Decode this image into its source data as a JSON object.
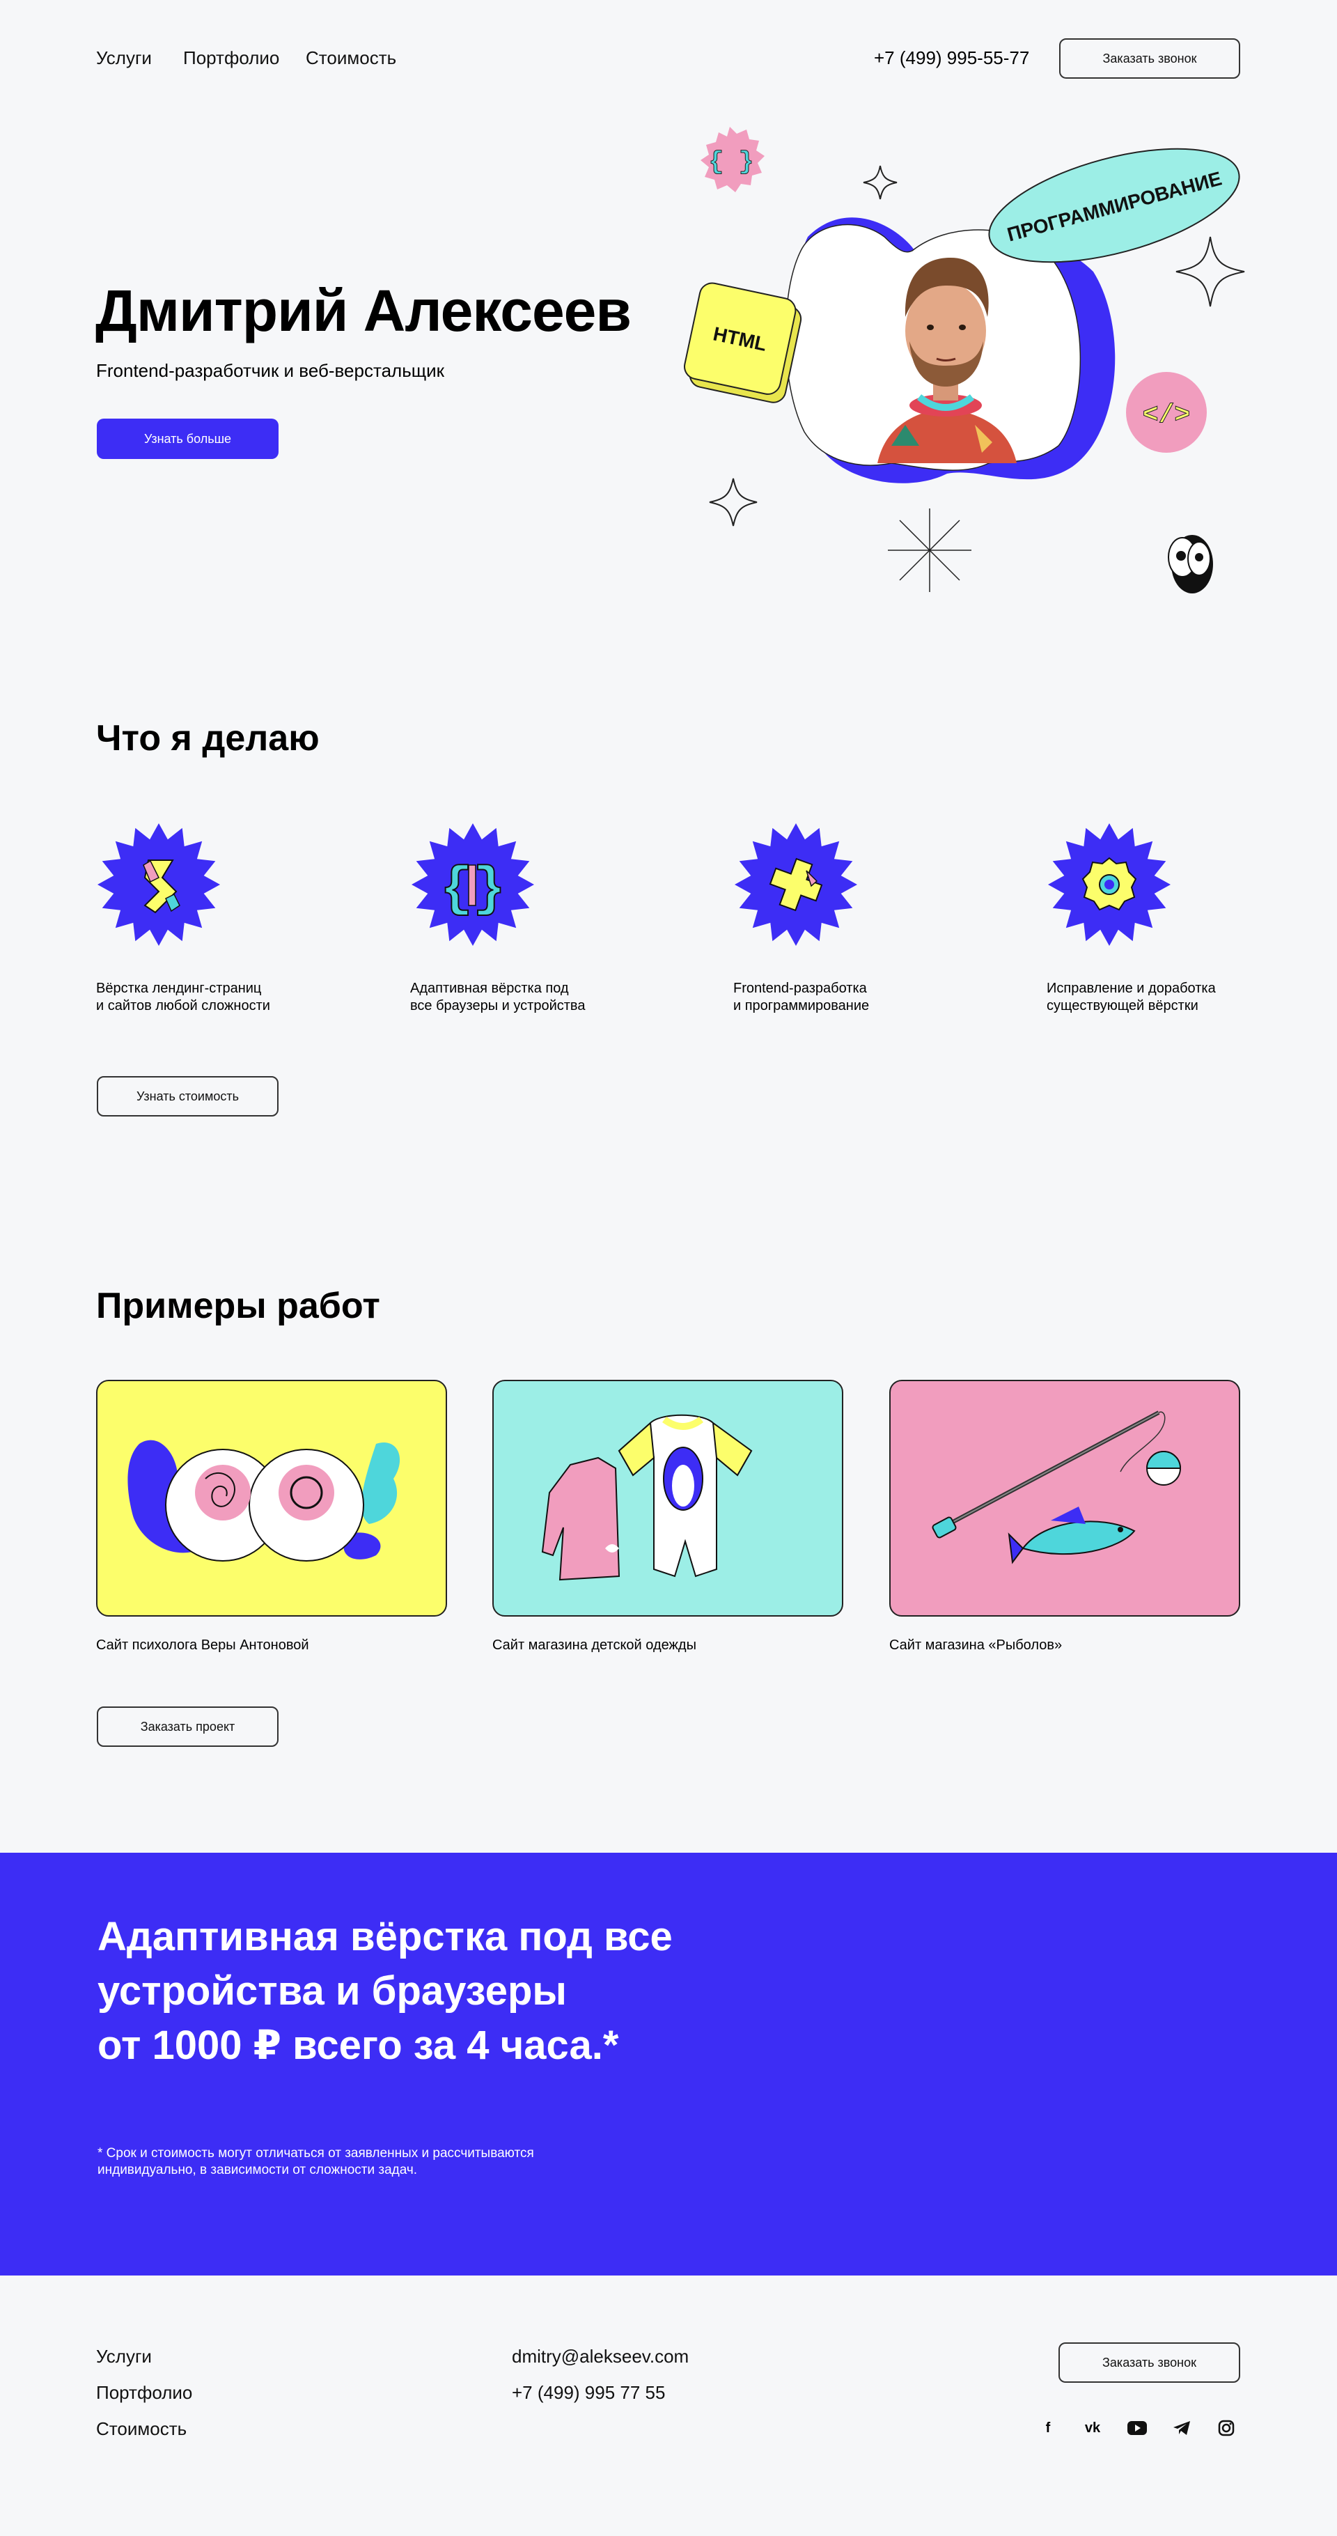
{
  "header": {
    "nav": [
      "Услуги",
      "Портфолио",
      "Стоимость"
    ],
    "phone": "+7 (499) 995-55-77",
    "call_button": "Заказать звонок"
  },
  "hero": {
    "title": "Дмитрий Алексеев",
    "subtitle": "Frontend-разработчик и веб-верстальщик",
    "button": "Узнать больше",
    "stickers": {
      "programming": "ПРОГРАММИРОВАНИЕ",
      "html": "HTML",
      "braces": "{ }",
      "tag": "</>"
    }
  },
  "services": {
    "title": "Что я делаю",
    "items": [
      {
        "text": "Вёрстка лендинг-страниц\nи сайтов любой сложности",
        "icon": "s-curve-icon"
      },
      {
        "text": "Адаптивная вёрстка под\nвсе браузеры и устройства",
        "icon": "braces-icon"
      },
      {
        "text": "Frontend-разработка\nи программирование",
        "icon": "cross-icon"
      },
      {
        "text": "Исправление и доработка\nсуществующей вёрстки",
        "icon": "gear-icon"
      }
    ],
    "button": "Узнать стоимость"
  },
  "works": {
    "title": "Примеры работ",
    "items": [
      {
        "caption": "Сайт психолога Веры Антоновой",
        "bg": "#FCFE6B"
      },
      {
        "caption": "Сайт магазина детской одежды",
        "bg": "#9CEEE6"
      },
      {
        "caption": "Сайт магазина «Рыболов»",
        "bg": "#F19DBE"
      }
    ],
    "button": "Заказать проект"
  },
  "promo": {
    "title": "Адаптивная вёрстка под все\nустройства и браузеры\nот 1000 ₽ всего за 4 часа.*",
    "note": "* Срок и стоимость могут отличаться от заявленных и рассчитываются\nиндивидуально, в зависимости от сложности задач."
  },
  "footer": {
    "nav": [
      "Услуги",
      "Портфолио",
      "Стоимость"
    ],
    "email": "dmitry@alekseev.com",
    "phone": "+7 (499) 995 77 55",
    "call_button": "Заказать звонок",
    "socials": [
      "facebook-icon",
      "vk-icon",
      "youtube-icon",
      "telegram-icon",
      "instagram-icon"
    ]
  },
  "colors": {
    "accent": "#3D2DF5",
    "background": "#F6F7F9",
    "yellow": "#FCFE6B",
    "mint": "#9CEEE6",
    "pink": "#F19DBE"
  }
}
